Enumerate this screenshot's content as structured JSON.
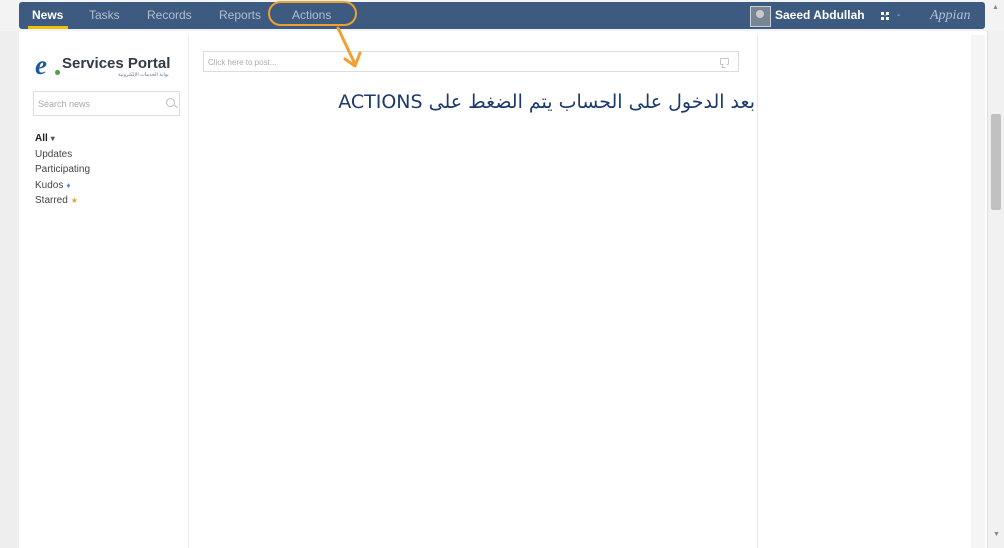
{
  "nav": {
    "tabs": [
      {
        "label": "News",
        "active": true
      },
      {
        "label": "Tasks",
        "active": false
      },
      {
        "label": "Records",
        "active": false
      },
      {
        "label": "Reports",
        "active": false
      },
      {
        "label": "Actions",
        "active": false,
        "highlighted": true
      }
    ],
    "user_name": "Saeed Abdullah",
    "user_caret": "-",
    "apps_caret": "-",
    "brand": "Appian"
  },
  "sidebar": {
    "logo": {
      "letter": "e",
      "title": "Services Portal",
      "subtitle": "بوابة الخدمات الإلكترونية"
    },
    "search_placeholder": "Search news",
    "filters": [
      {
        "label": "All",
        "marker": "▾",
        "active": true
      },
      {
        "label": "Updates"
      },
      {
        "label": "Participating"
      },
      {
        "label": "Kudos",
        "marker": "♦"
      },
      {
        "label": "Starred",
        "marker": "★"
      }
    ]
  },
  "feed": {
    "post_placeholder": "Click here to post...",
    "instruction": "بعد الدخول على الحساب يتم الضغط على ACTIONS"
  },
  "colors": {
    "nav_bar": "#3d5a80",
    "active_tab_underline": "#f5c000",
    "annotation_orange": "#f0a030",
    "instruction_text": "#1c3a6e"
  },
  "icons": [
    "search-icon",
    "comment-icon",
    "apps-grid-icon",
    "user-avatar",
    "annotation-arrow"
  ]
}
